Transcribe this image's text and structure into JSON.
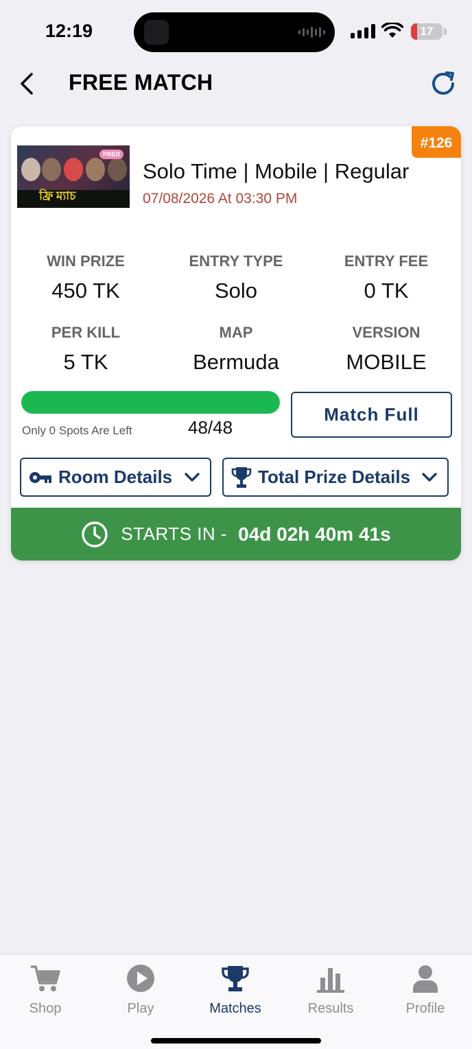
{
  "status_bar": {
    "time": "12:19",
    "battery": "17"
  },
  "header": {
    "title": "FREE MATCH"
  },
  "match": {
    "badge": "#126",
    "thumbnail_text": "ফ্রি ম্যাচ",
    "thumbnail_pill": "PRER",
    "title": "Solo Time | Mobile | Regular",
    "datetime": "07/08/2026 At 03:30 PM",
    "stats": [
      {
        "label": "WIN PRIZE",
        "value": "450 TK"
      },
      {
        "label": "ENTRY TYPE",
        "value": "Solo"
      },
      {
        "label": "ENTRY FEE",
        "value": "0 TK"
      },
      {
        "label": "PER KILL",
        "value": "5 TK"
      },
      {
        "label": "MAP",
        "value": "Bermuda"
      },
      {
        "label": "VERSION",
        "value": "MOBILE"
      }
    ],
    "progress_fraction": 1.0,
    "spots_left_text": "Only 0 Spots Are Left",
    "joined_count": "48/48",
    "full_button_label": "Match Full",
    "room_details_label": "Room Details",
    "prize_details_label": "Total Prize Details",
    "starts_in_label": "STARTS IN -",
    "countdown": "04d 02h 40m 41s"
  },
  "colors": {
    "accent_navy": "#1b3a6b",
    "badge_orange": "#f5820f",
    "progress_green": "#1bb851",
    "starts_bar_green": "#3d9448",
    "date_red": "#b0463c"
  },
  "tabbar": {
    "items": [
      {
        "label": "Shop",
        "icon": "cart-icon",
        "active": false
      },
      {
        "label": "Play",
        "icon": "play-icon",
        "active": false
      },
      {
        "label": "Matches",
        "icon": "trophy-icon",
        "active": true
      },
      {
        "label": "Results",
        "icon": "bar-chart-icon",
        "active": false
      },
      {
        "label": "Profile",
        "icon": "person-icon",
        "active": false
      }
    ]
  }
}
